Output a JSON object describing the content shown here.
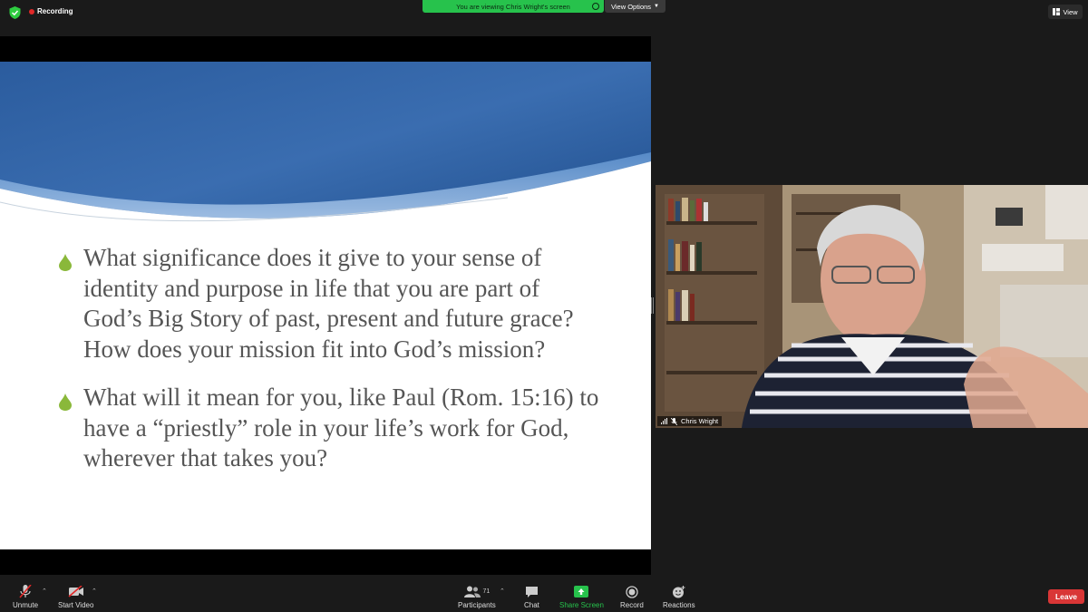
{
  "top_bar": {
    "recording_label": "Recording",
    "viewing_banner": "You are viewing Chris Wright's screen",
    "view_options_label": "View Options",
    "view_label": "View"
  },
  "slide": {
    "bullets": [
      "What significance does it give to your sense of identity and purpose in life that you are part of God’s Big Story of past, present and future grace? How does your mission fit into God’s mission?",
      "What will it mean for you, like Paul (Rom. 15:16) to have a “priestly” role in your life’s work for God, wherever that takes you?"
    ],
    "bullet_icon": "green-drop-icon",
    "accent_color": "#8ab83a"
  },
  "video_tile": {
    "participant_name": "Chris Wright"
  },
  "toolbar": {
    "unmute_label": "Unmute",
    "start_video_label": "Start Video",
    "participants_label": "Participants",
    "participants_count": "71",
    "chat_label": "Chat",
    "share_screen_label": "Share Screen",
    "record_label": "Record",
    "reactions_label": "Reactions",
    "leave_label": "Leave"
  },
  "colors": {
    "share_green": "#27c24c",
    "leave_red": "#d93636",
    "recording_red": "#e02828"
  }
}
